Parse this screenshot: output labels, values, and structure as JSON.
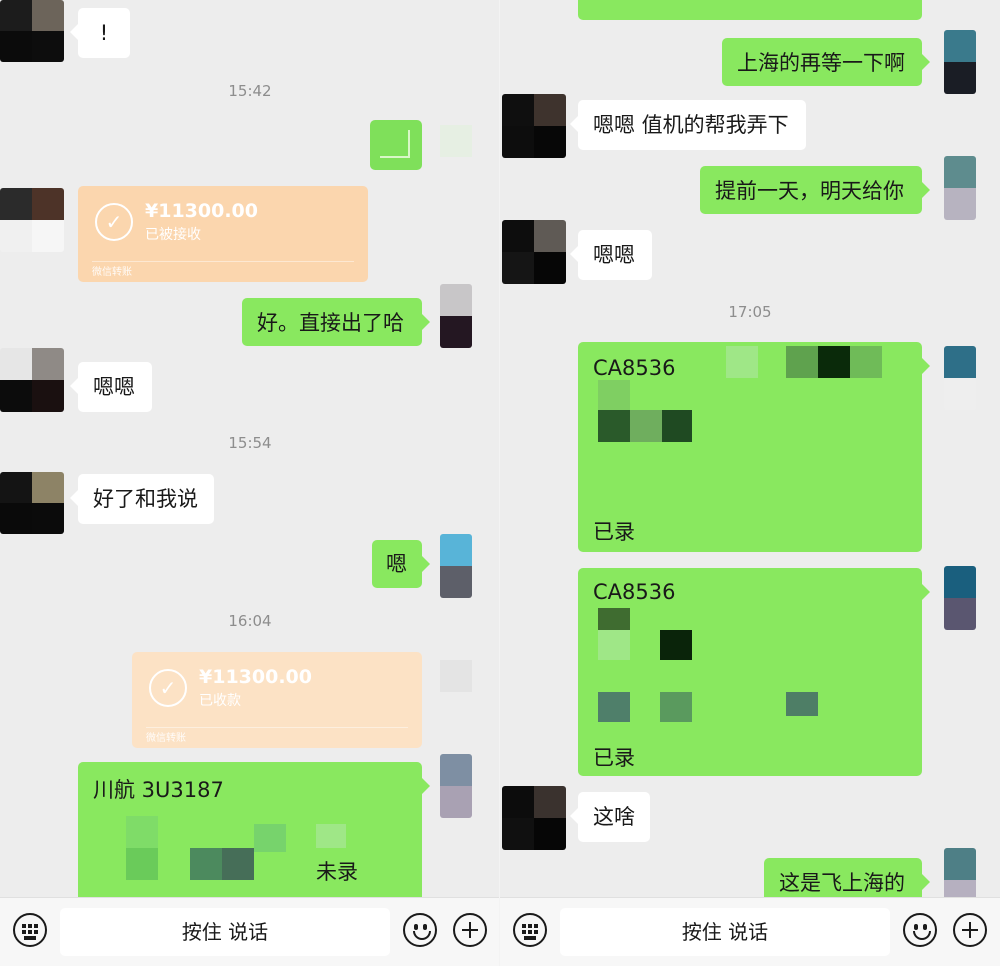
{
  "left": {
    "messages": {
      "m1": "!",
      "t1": "15:42",
      "transfer1": {
        "amount": "¥11300.00",
        "status": "已被接收",
        "footer": "微信转账"
      },
      "m2": "好。直接出了哈",
      "m3": "嗯嗯",
      "t2": "15:54",
      "m4": "好了和我说",
      "m5": "嗯",
      "t3": "16:04",
      "transfer2": {
        "amount": "¥11300.00",
        "status": "已收款",
        "footer": "微信转账"
      },
      "card1": {
        "title": "川航 3U3187",
        "note": "未录"
      }
    },
    "input": {
      "talk_label": "按住 说话"
    }
  },
  "right": {
    "messages": {
      "m1": "上海的再等一下啊",
      "m2": "嗯嗯 值机的帮我弄下",
      "m3": "提前一天，明天给你",
      "m4": "嗯嗯",
      "t1": "17:05",
      "card1": {
        "title": "CA8536",
        "note": "已录"
      },
      "card2": {
        "title": "CA8536",
        "note": "已录"
      },
      "m5": "这啥",
      "m6": "这是飞上海的"
    },
    "input": {
      "talk_label": "按住 说话"
    }
  },
  "colors": {
    "bubble_out": "#89e85f",
    "bubble_in": "#ffffff",
    "transfer": "#fbd6ae",
    "background": "#ededed"
  },
  "icons": [
    "keyboard-icon",
    "emoji-icon",
    "plus-icon",
    "check-circle-icon"
  ]
}
